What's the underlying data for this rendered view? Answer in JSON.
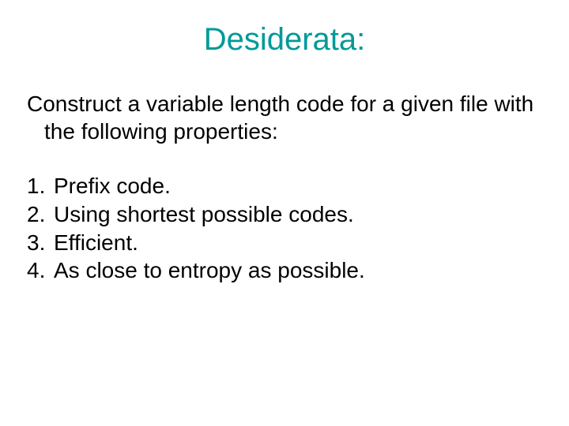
{
  "title": "Desiderata:",
  "title_color": "#009999",
  "intro": "Construct a variable length code for a given file with the following properties:",
  "items": [
    {
      "num": "1.",
      "text": "Prefix code."
    },
    {
      "num": "2.",
      "text": "Using shortest possible codes."
    },
    {
      "num": "3.",
      "text": "Efficient."
    },
    {
      "num": "4.",
      "text": "As close to entropy as possible."
    }
  ]
}
